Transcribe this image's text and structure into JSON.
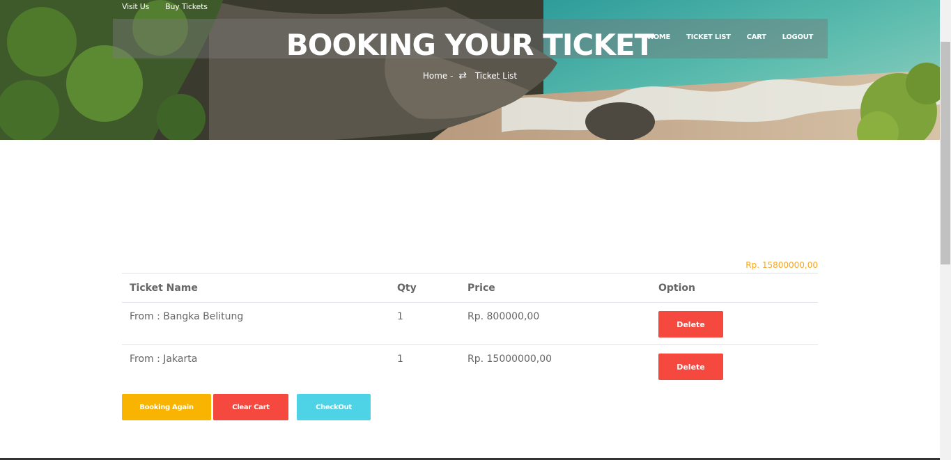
{
  "top_links": {
    "visit": "Visit Us",
    "buy": "Buy Tickets"
  },
  "nav": {
    "home": "HOME",
    "ticket_list": "TICKET LIST",
    "cart": "CART",
    "logout": "LOGOUT"
  },
  "hero": {
    "title": "BOOKING YOUR TICKET",
    "breadcrumb_home": "Home",
    "breadcrumb_separator": "-",
    "breadcrumb_arrow": "⇄",
    "breadcrumb_current": "Ticket List"
  },
  "cart": {
    "total": "Rp. 15800000,00",
    "headers": {
      "name": "Ticket Name",
      "qty": "Qty",
      "price": "Price",
      "option": "Option"
    },
    "rows": [
      {
        "name": "From : Bangka Belitung",
        "qty": "1",
        "price": "Rp. 800000,00",
        "action": "Delete"
      },
      {
        "name": "From : Jakarta",
        "qty": "1",
        "price": "Rp. 15000000,00",
        "action": "Delete"
      }
    ]
  },
  "actions": {
    "booking_again": "Booking Again",
    "clear_cart": "Clear Cart",
    "checkout": "CheckOut"
  },
  "colors": {
    "yellow": "#f8b400",
    "red": "#f5483f",
    "cyan": "#4dd3e5",
    "total": "#f5a623"
  }
}
